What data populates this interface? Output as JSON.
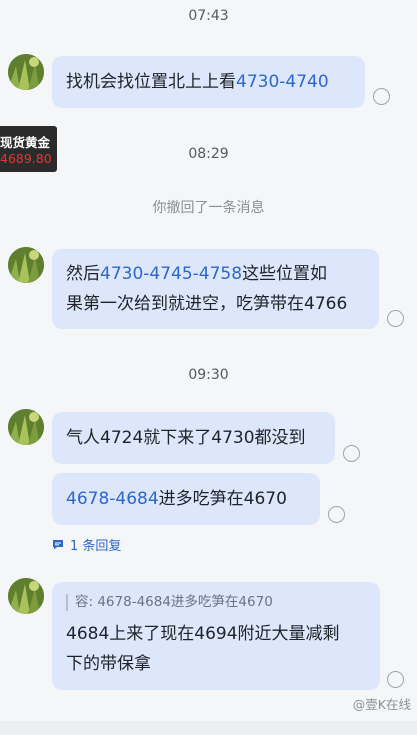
{
  "times": [
    "07:43",
    "08:29",
    "09:30"
  ],
  "notice": "你撤回了一条消息",
  "ticker": {
    "name": "现货黄金",
    "price": "4689.80"
  },
  "messages": {
    "m1": {
      "pre": "找机会找位置北上上看",
      "num": "4730-4740"
    },
    "m2": {
      "num": "4730-4745-4758",
      "line1_pre": "然后",
      "line1_post": "这些位置如",
      "line2": "果第一次给到就进空，吃笋带在4766"
    },
    "m3": {
      "text": "气人4724就下来了4730都没到"
    },
    "m4": {
      "num": "4678-4684",
      "post": "进多吃笋在4670"
    },
    "m5": {
      "quote": "容: 4678-4684进多吃笋在4670",
      "line1": "4684上来了现在4694附近大量减剩",
      "line2": "下的带保拿"
    }
  },
  "reply_link": "1 条回复",
  "watermark": "@壹K在线",
  "colors": {
    "bubble": "#dde7fb",
    "link": "#2e67c8",
    "background": "#f5f6f8"
  }
}
